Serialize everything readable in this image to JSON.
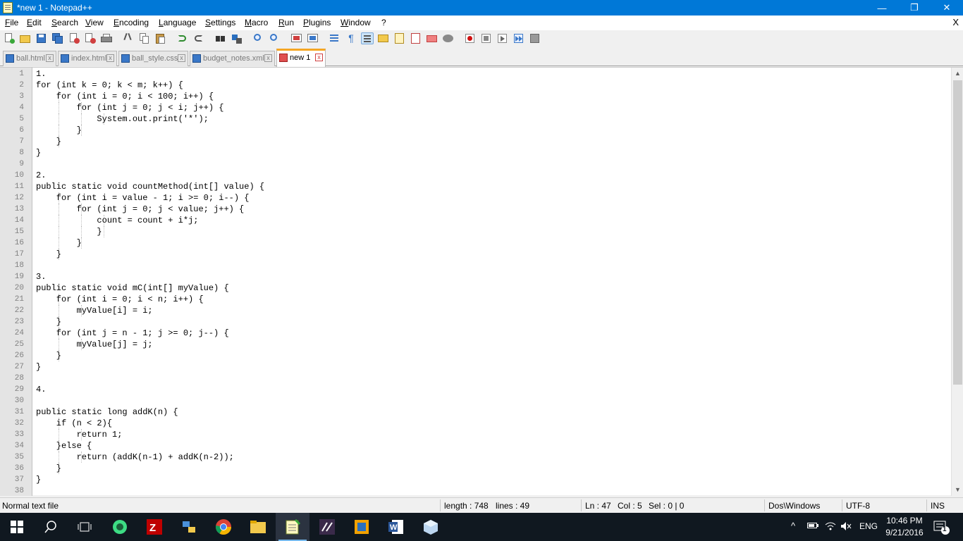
{
  "window": {
    "title": "*new 1 - Notepad++",
    "minimize": "—",
    "restore": "❐",
    "close": "✕"
  },
  "menu": [
    "File",
    "Edit",
    "Search",
    "View",
    "Encoding",
    "Language",
    "Settings",
    "Macro",
    "Run",
    "Plugins",
    "Window",
    "?"
  ],
  "menu_close": "X",
  "tabs": [
    {
      "label": "ball.html",
      "active": false
    },
    {
      "label": "index.html",
      "active": false
    },
    {
      "label": "ball_style.css",
      "active": false
    },
    {
      "label": "budget_notes.xml",
      "active": false
    },
    {
      "label": "new 1",
      "active": true
    }
  ],
  "tab_close": "x",
  "editor": {
    "lines": [
      "1.",
      "for (int k = 0; k < m; k++) {",
      "    for (int i = 0; i < 100; i++) {",
      "        for (int j = 0; j < i; j++) {",
      "            System.out.print('*');",
      "        }",
      "    }",
      "}",
      "",
      "2.",
      "public static void countMethod(int[] value) {",
      "    for (int i = value - 1; i >= 0; i--) {",
      "        for (int j = 0; j < value; j++) {",
      "            count = count + i*j;",
      "            }",
      "        }",
      "    }",
      "",
      "3.",
      "public static void mC(int[] myValue) {",
      "    for (int i = 0; i < n; i++) {",
      "        myValue[i] = i;",
      "    }",
      "    for (int j = n - 1; j >= 0; j--) {",
      "        myValue[j] = j;",
      "    }",
      "}",
      "",
      "4.",
      "",
      "public static long addK(n) {",
      "    if (n < 2){",
      "        return 1;",
      "    }else {",
      "        return (addK(n-1) + addK(n-2));",
      "    }",
      "}",
      ""
    ]
  },
  "status": {
    "file_type": "Normal text file",
    "length": "length : 748",
    "lines": "lines : 49",
    "ln": "Ln : 47",
    "col": "Col : 5",
    "sel": "Sel : 0 | 0",
    "eol": "Dos\\Windows",
    "encoding": "UTF-8",
    "mode": "INS"
  },
  "taskbar": {
    "lang": "ENG",
    "time": "10:46 PM",
    "date": "9/21/2016",
    "notifications": "1"
  },
  "colors": {
    "titlebar": "#0078d7",
    "active_tab_accent": "#f5a623",
    "taskbar": "#101820"
  }
}
